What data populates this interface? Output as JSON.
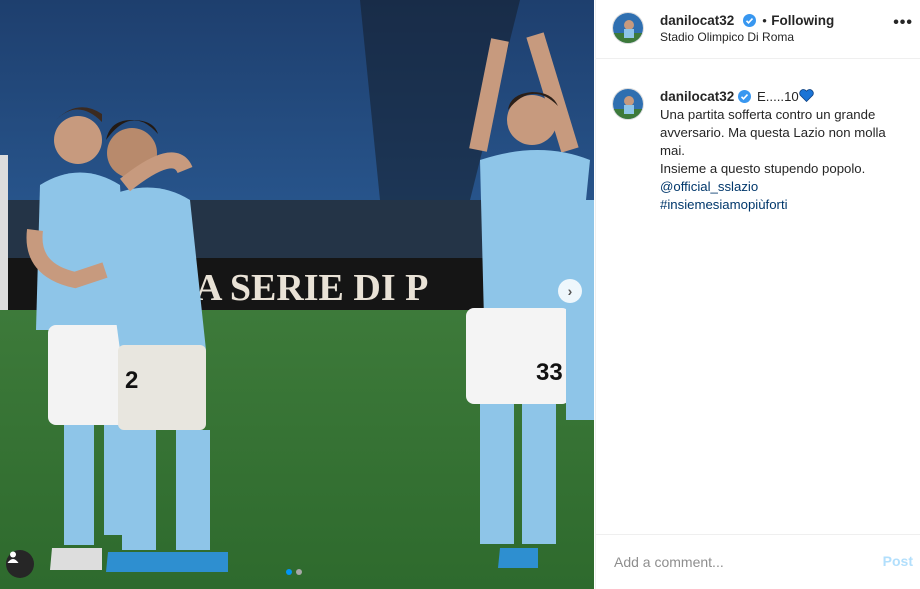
{
  "post": {
    "username": "danilocat32",
    "follow_separator": "•",
    "follow_status": "Following",
    "location": "Stadio Olimpico Di Roma",
    "more_label": "•••",
    "image": {
      "banner_text": "A SERIE DI P",
      "jersey_left": "2",
      "jersey_right": "33",
      "slide_count": 2,
      "active_slide": 0
    }
  },
  "caption": {
    "username": "danilocat32",
    "headline": "E.....10",
    "lines": [
      "Una partita sofferta contro un grande",
      "avversario. Ma questa Lazio non molla",
      "mai.",
      "Insieme a questo stupendo popolo."
    ],
    "mention": "@official_sslazio",
    "hashtag": "#insiemesiamopiùforti"
  },
  "comment_box": {
    "placeholder": "Add a comment...",
    "post_label": "Post"
  },
  "colors": {
    "accent": "#0095f6",
    "link": "#00376b",
    "post_disabled": "#b2dffc",
    "lazio_blue": "#8ec5e8"
  }
}
